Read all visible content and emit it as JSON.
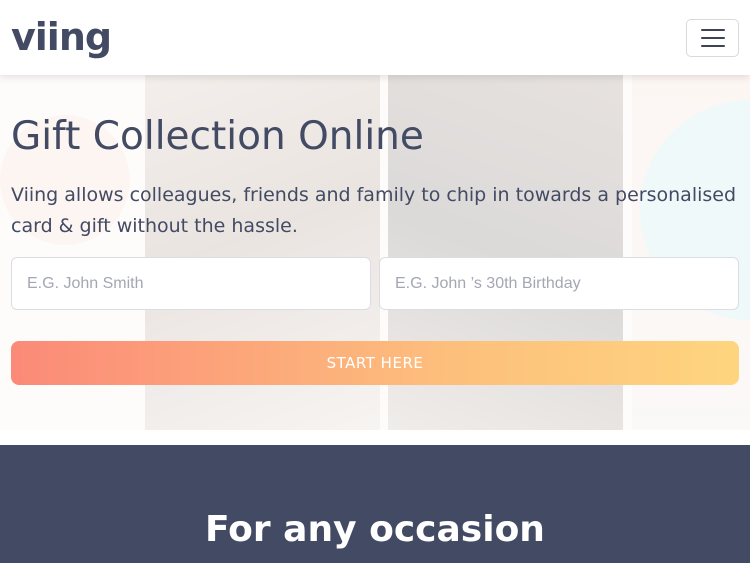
{
  "navbar": {
    "logo_text": "viing",
    "menu_icon": "hamburger-menu-icon"
  },
  "hero": {
    "title": "Gift Collection Online",
    "subtitle": "Viing allows colleagues, friends and family to chip in towards a personalised card & gift without the hassle.",
    "name_field": {
      "value": "",
      "placeholder": "E.G. John Smith"
    },
    "occasion_field": {
      "value": "",
      "placeholder": "E.G. John ’s 30th Birthday"
    },
    "start_label": "START HERE"
  },
  "occasion_section": {
    "heading": "For any occasion"
  },
  "colors": {
    "brand_navy": "#434a63",
    "button_gradient_start": "#fb8a78",
    "button_gradient_end": "#fed57f",
    "teal_accent": "#b7e3e6"
  }
}
